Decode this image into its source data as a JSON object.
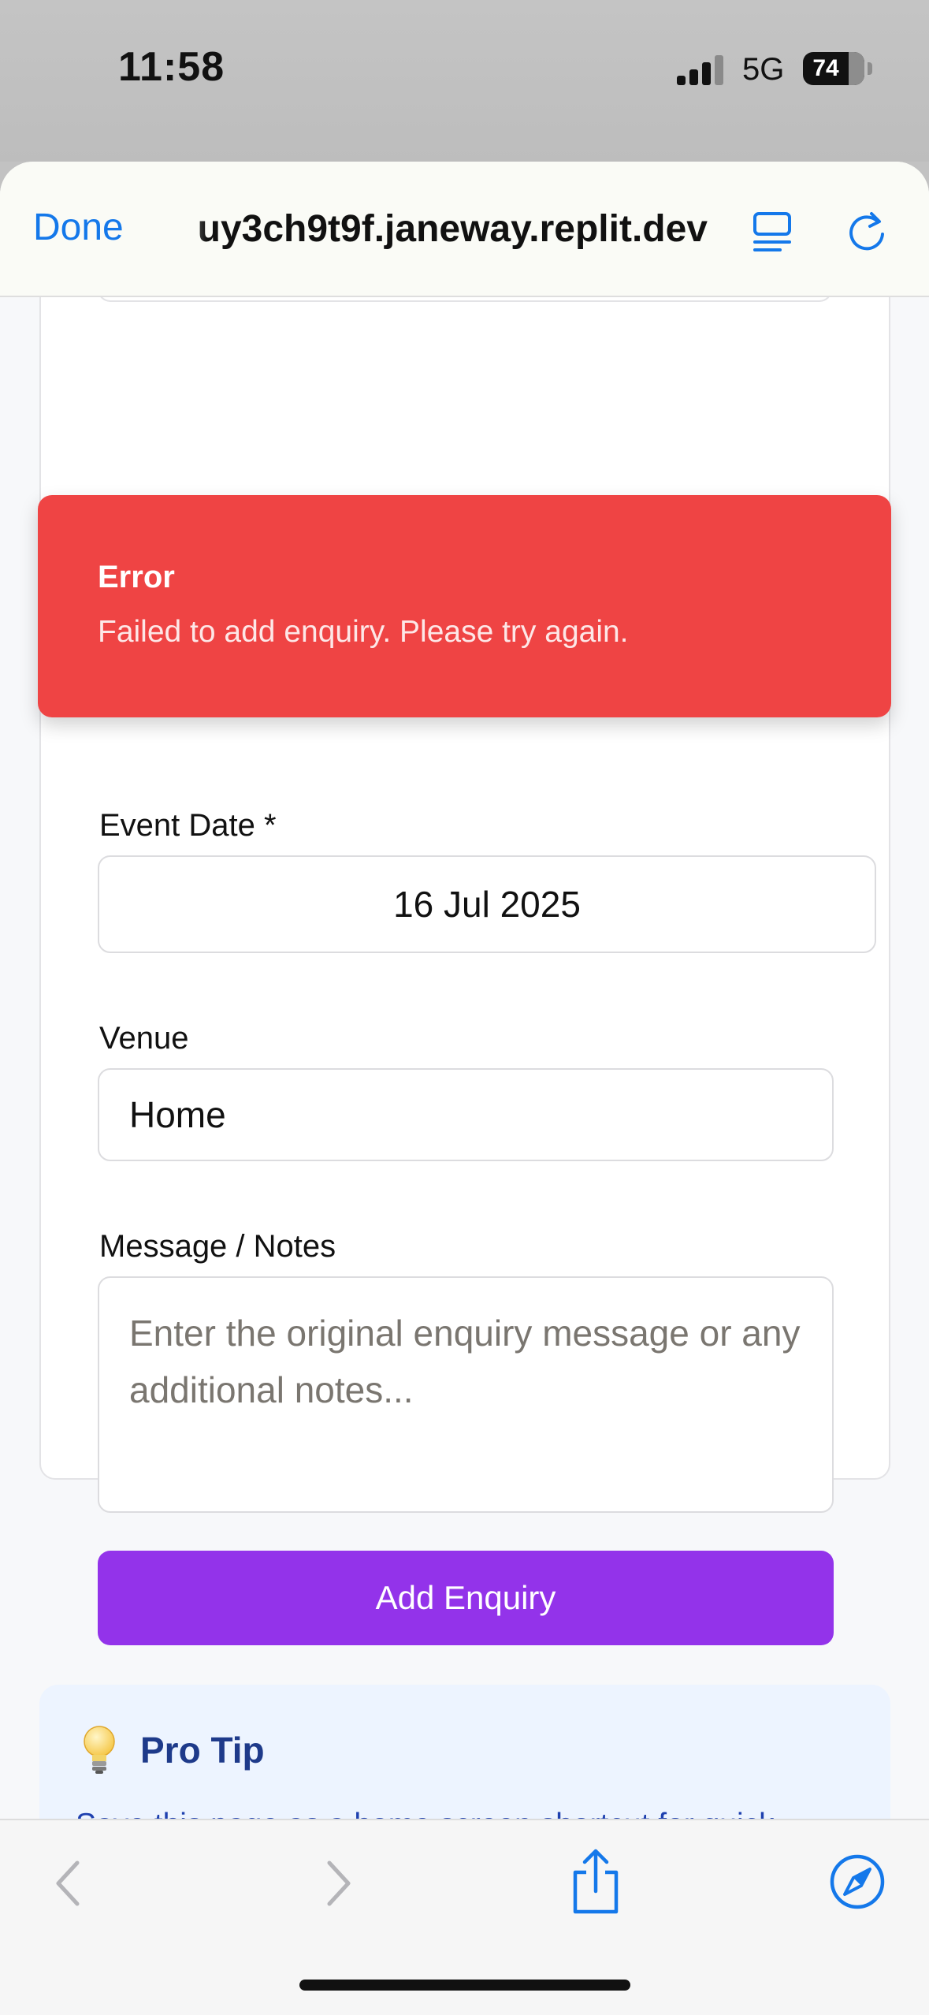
{
  "status_bar": {
    "time": "11:58",
    "network": "5G",
    "battery_percent": 74,
    "battery_label": "74"
  },
  "browser": {
    "done_label": "Done",
    "url": "uy3ch9t9f.janeway.replit.dev",
    "accent_color": "#1478ea"
  },
  "toast": {
    "title": "Error",
    "message": "Failed to add enquiry. Please try again.",
    "color": "#ef4444"
  },
  "form": {
    "event_date_label": "Event Date *",
    "event_date_value": "16 Jul 2025",
    "venue_label": "Venue",
    "venue_value": "Home",
    "notes_label": "Message / Notes",
    "notes_placeholder": "Enter the original enquiry message or any additional notes...",
    "submit_label": "Add Enquiry",
    "submit_color": "#9333ea"
  },
  "tip": {
    "title": "Pro Tip",
    "text": "Save this page as a home screen shortcut for quick access when you receive enquiries on the go!",
    "icon": "lightbulb-icon"
  },
  "toolbar": {
    "icons": [
      "back-icon",
      "forward-icon",
      "share-icon",
      "compass-icon"
    ]
  }
}
